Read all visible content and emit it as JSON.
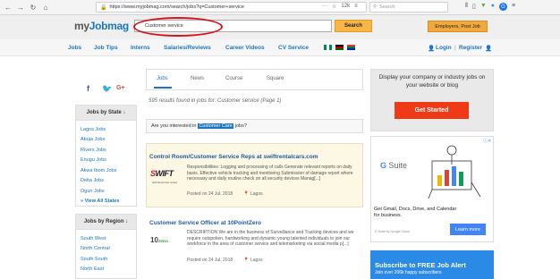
{
  "browser": {
    "url": "https://www.myjobmag.com/search/jobs?q=Customer+service",
    "zoom": "12k",
    "search_placeholder": "Search"
  },
  "site": {
    "logo_my": "my",
    "logo_job": "Jobmag",
    "search_value": "Customer service",
    "search_button": "Search",
    "employer_button": "Employers, Post Job"
  },
  "nav": {
    "items": [
      "Jobs",
      "Job Tips",
      "Interns",
      "Salaries/Reviews",
      "Career Videos",
      "CV Service"
    ],
    "login": "Login",
    "register": "Register"
  },
  "sidebar": {
    "state_header": "Jobs by State",
    "states": [
      "Lagos Jobs",
      "Abuja Jobs",
      "Rivers Jobs",
      "Enugu Jobs",
      "Akwa Ibom Jobs",
      "Delta Jobs",
      "Ogun Jobs"
    ],
    "view_all": "» View All States",
    "region_header": "Jobs by Region",
    "regions": [
      "South West",
      "North Central",
      "South South",
      "North East"
    ]
  },
  "main": {
    "tabs": [
      "Jobs",
      "News",
      "Course",
      "Square"
    ],
    "results": "595 results found in jobs for: Customer service (Page 1)",
    "interest_prefix": "Are you interested in",
    "interest_link": "Customer Care",
    "interest_suffix": "jobs?",
    "jobs": [
      {
        "title": "Control Room/Customer Service Reps at swiftrentalcars.com",
        "desc": "Responsibilities: Logging and processing of calls Generate relevant reports on daily basis. Effective vehicle tracking and monitoring Submission of damage report where necessary and daily routine check on all security devices Manag[...]",
        "posted": "Posted on 24 Jul, 2018",
        "location": "Lagos",
        "logo_text": "SWIFT",
        "logo_sub": "Swift Rental Cars Limited"
      },
      {
        "title": "Customer Service Officer at 10PointZero",
        "desc": "DESCRIPTION We are in the business of Surveillance and Tracking devices and we require outspoken, hardworking and dynamic young talented individuals to join our workforce in the area of customer service and telemarketing via social media p[...]",
        "posted": "Posted on 24 Jul, 2018",
        "location": "Lagos",
        "logo_text": "10",
        "logo_sub": "ZERO"
      }
    ]
  },
  "promo": {
    "text": "Display your company or industry jobs on your website or blog",
    "button": "Get Started"
  },
  "ad": {
    "brand_g": "G",
    "brand_rest": "Suite",
    "text": "Get Gmail, Docs, Drive, and Calendar for business.",
    "learn": "Learn more",
    "foot": "G Suite by Google Cloud"
  },
  "subscribe": {
    "title": "Subscribe to FREE Job Alert",
    "text": "Join over 206k happy subscribers"
  },
  "colors": {
    "brand_blue": "#1c76bb",
    "accent_orange": "#f7b645",
    "cta_red": "#f03a17"
  }
}
